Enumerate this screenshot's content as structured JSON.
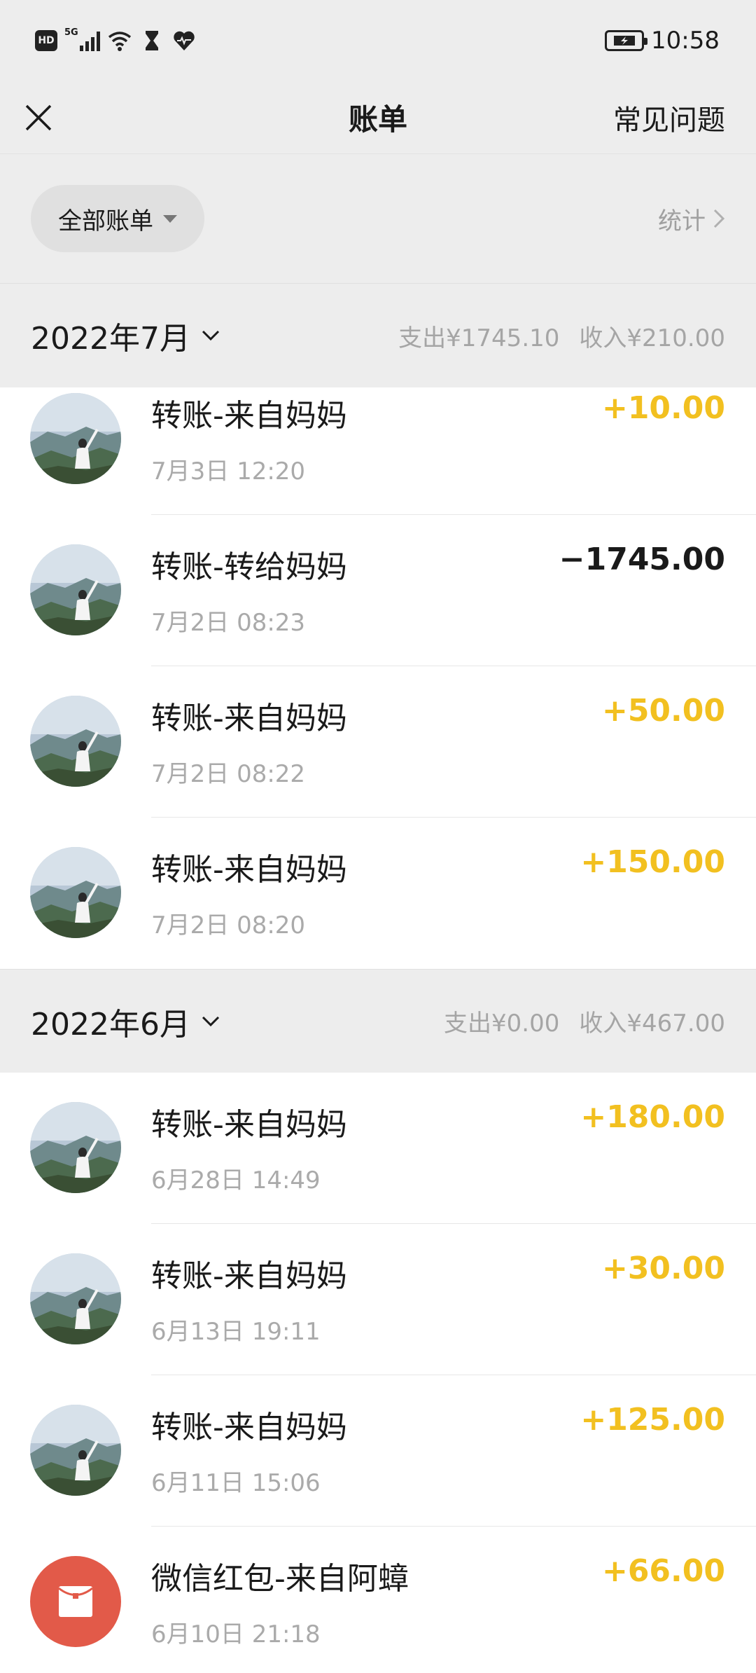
{
  "status_bar": {
    "hd": "HD",
    "signal": "5G",
    "time": "10:58",
    "icons": [
      "hd-icon",
      "signal-icon",
      "wifi-icon",
      "hourglass-icon",
      "heart-icon",
      "battery-icon"
    ]
  },
  "nav": {
    "title": "账单",
    "faq": "常见问题"
  },
  "filter": {
    "all_bills": "全部账单",
    "stats": "统计"
  },
  "months": [
    {
      "label": "2022年7月",
      "expense": "支出¥1745.10",
      "income": "收入¥210.00",
      "transactions": [
        {
          "title": "转账-来自妈妈",
          "time": "7月3日 12:20",
          "amount": "+10.00",
          "type": "income"
        },
        {
          "title": "转账-转给妈妈",
          "time": "7月2日 08:23",
          "amount": "−1745.00",
          "type": "expense"
        },
        {
          "title": "转账-来自妈妈",
          "time": "7月2日 08:22",
          "amount": "+50.00",
          "type": "income"
        },
        {
          "title": "转账-来自妈妈",
          "time": "7月2日 08:20",
          "amount": "+150.00",
          "type": "income"
        }
      ]
    },
    {
      "label": "2022年6月",
      "expense": "支出¥0.00",
      "income": "收入¥467.00",
      "transactions": [
        {
          "title": "转账-来自妈妈",
          "time": "6月28日 14:49",
          "amount": "+180.00",
          "type": "income"
        },
        {
          "title": "转账-来自妈妈",
          "time": "6月13日 19:11",
          "amount": "+30.00",
          "type": "income"
        },
        {
          "title": "转账-来自妈妈",
          "time": "6月11日 15:06",
          "amount": "+125.00",
          "type": "income"
        },
        {
          "title": "微信红包-来自阿蟑",
          "time": "6月10日 21:18",
          "amount": "+66.00",
          "type": "income"
        }
      ]
    }
  ],
  "colors": {
    "income": "#f2c020",
    "expense": "#1a1a1a",
    "background_gray": "#ededed",
    "red_packet": "#e25a49"
  }
}
